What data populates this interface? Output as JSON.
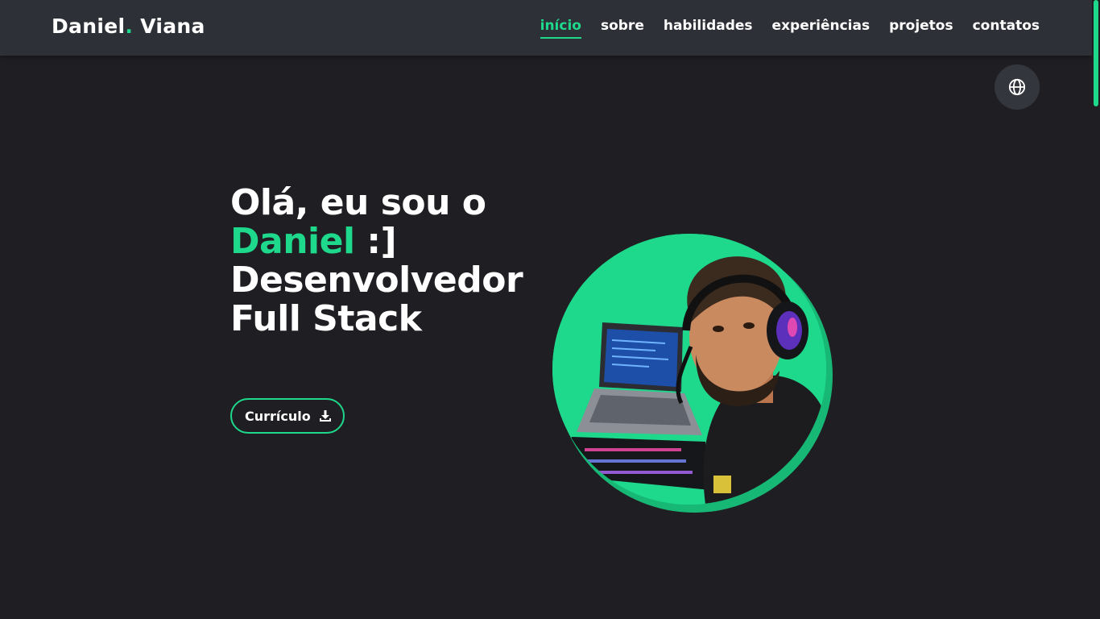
{
  "logo": {
    "first": "Daniel",
    "dot": ".",
    "last": " Viana"
  },
  "nav": {
    "items": [
      {
        "label": "início",
        "active": true
      },
      {
        "label": "sobre",
        "active": false
      },
      {
        "label": "habilidades",
        "active": false
      },
      {
        "label": "experiências",
        "active": false
      },
      {
        "label": "projetos",
        "active": false
      },
      {
        "label": "contatos",
        "active": false
      }
    ]
  },
  "hero": {
    "line1": "Olá, eu sou o",
    "name": "Daniel",
    "smiley": " :]",
    "line3": "Desenvolvedor",
    "line4": "Full Stack",
    "cv_label": "Currículo"
  },
  "icons": {
    "language": "globe-icon",
    "download": "download-icon"
  },
  "colors": {
    "accent": "#1ed88c",
    "header_bg": "#2e3037",
    "page_bg": "#1f1f23"
  }
}
